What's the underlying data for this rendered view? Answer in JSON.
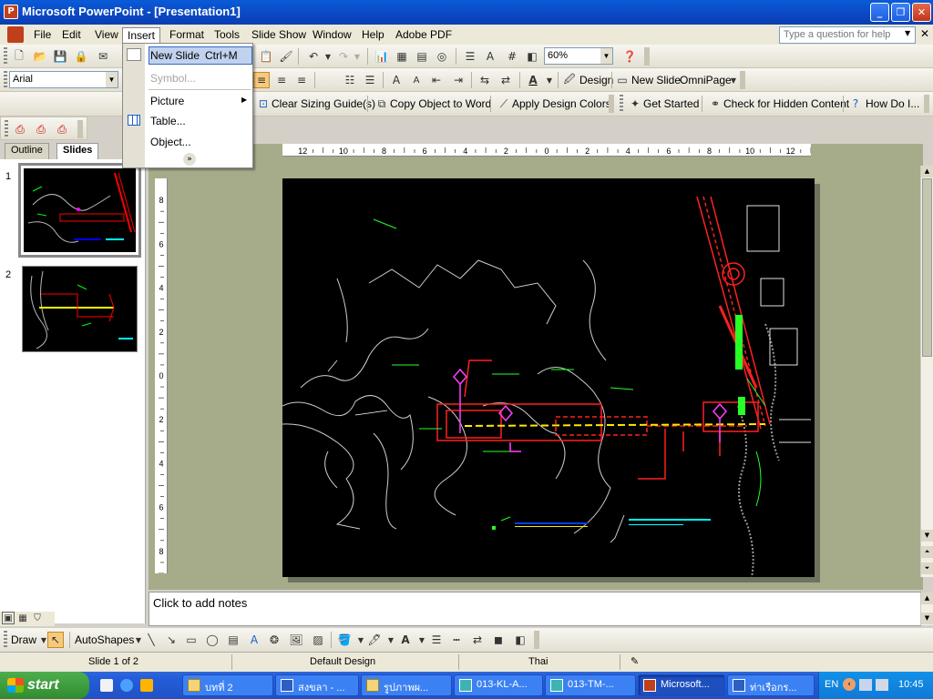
{
  "window": {
    "title": "Microsoft PowerPoint - [Presentation1]"
  },
  "menubar": {
    "items": [
      "File",
      "Edit",
      "View",
      "Insert",
      "Format",
      "Tools",
      "Slide Show",
      "Window",
      "Help",
      "Adobe PDF"
    ],
    "help_placeholder": "Type a question for help"
  },
  "insert_menu": {
    "items": [
      {
        "label": "New Slide",
        "shortcut": "Ctrl+M"
      },
      {
        "label": "Symbol..."
      },
      {
        "label": "Picture"
      },
      {
        "label": "Table..."
      },
      {
        "label": "Object..."
      }
    ]
  },
  "toolbar": {
    "zoom": "60%",
    "font": "Arial",
    "design_label": "Design",
    "new_slide_label": "New Slide",
    "omnipage_label": "OmniPage",
    "clear_guides": "Clear Sizing Guide(s)",
    "copy_to_word": "Copy Object to Word",
    "apply_colors": "Apply Design Colors",
    "get_started": "Get Started",
    "check_hidden": "Check for Hidden Content",
    "how_do_i": "How Do I..."
  },
  "panel": {
    "tabs": [
      "Outline",
      "Slides"
    ],
    "slide_numbers": [
      "1",
      "2"
    ]
  },
  "ruler": {
    "labels": [
      "12",
      "10",
      "8",
      "6",
      "4",
      "2",
      "0",
      "2",
      "4",
      "6",
      "8",
      "10",
      "12"
    ],
    "vlabels": [
      "8",
      "6",
      "4",
      "2",
      "0",
      "2",
      "4",
      "6",
      "8"
    ]
  },
  "notes": {
    "placeholder": "Click to add notes"
  },
  "drawbar": {
    "draw_label": "Draw",
    "autoshapes_label": "AutoShapes"
  },
  "status": {
    "slide": "Slide 1 of 2",
    "design": "Default Design",
    "language": "Thai"
  },
  "taskbar": {
    "start_label": "start",
    "tasks": [
      "บทที่ 2",
      "สงขลา - ...",
      "รูปภาพผ...",
      "013-KL-A...",
      "013-TM-...",
      "Microsoft...",
      "ท่าเรือกร..."
    ],
    "lang": "EN",
    "clock": "10:45"
  }
}
